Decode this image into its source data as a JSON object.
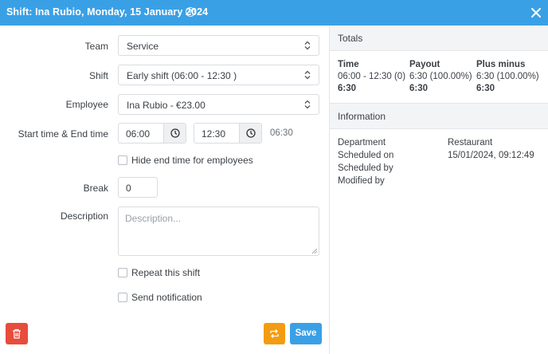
{
  "dialog": {
    "title": "Shift: Ina Rubio, Monday, 15 January 2024",
    "help_glyph": "?"
  },
  "form": {
    "team": {
      "label": "Team",
      "value": "Service"
    },
    "shift": {
      "label": "Shift",
      "value": "Early shift (06:00 - 12:30 )"
    },
    "employee": {
      "label": "Employee",
      "value": "Ina Rubio - €23.00"
    },
    "time": {
      "label": "Start time & End time",
      "start": "06:00",
      "end": "12:30",
      "duration": "06:30"
    },
    "hide_end_time": {
      "label": "Hide end time for employees",
      "checked": false
    },
    "break": {
      "label": "Break",
      "value": "0"
    },
    "description": {
      "label": "Description",
      "placeholder": "Description..."
    },
    "repeat": {
      "label": "Repeat this shift",
      "checked": false
    },
    "notify": {
      "label": "Send notification",
      "checked": false
    }
  },
  "buttons": {
    "save": "Save",
    "delete_icon": "trash-icon",
    "repeat_icon": "repeat-icon"
  },
  "totals": {
    "header": "Totals",
    "columns": [
      {
        "title": "Time",
        "line1": "06:00 - 12:30 (0)",
        "line2": "6:30"
      },
      {
        "title": "Payout",
        "line1": "6:30 (100.00%)",
        "line2": "6:30"
      },
      {
        "title": "Plus minus",
        "line1": "6:30 (100.00%)",
        "line2": "6:30"
      }
    ]
  },
  "information": {
    "header": "Information",
    "rows": [
      {
        "label": "Department",
        "value": "Restaurant"
      },
      {
        "label": "Scheduled on",
        "value": "15/01/2024, 09:12:49"
      },
      {
        "label": "Scheduled by",
        "value": ""
      },
      {
        "label": "Modified by",
        "value": ""
      }
    ]
  },
  "colors": {
    "header_blue": "#3aa0e6",
    "delete_red": "#e74c3c",
    "repeat_orange": "#f39c12",
    "save_blue": "#3aa0e6"
  }
}
